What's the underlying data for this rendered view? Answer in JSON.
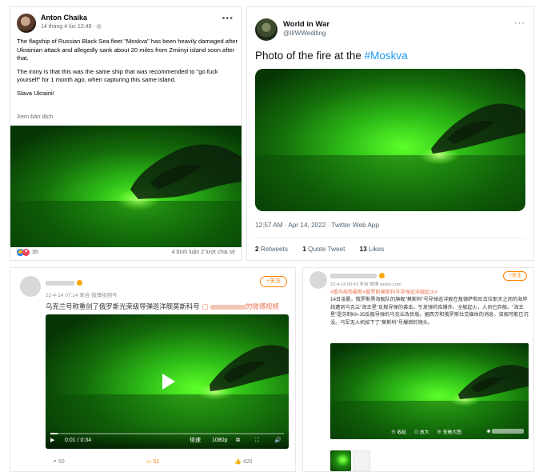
{
  "colors": {
    "facebook_like": "#1877f2",
    "facebook_love": "#f33e58",
    "twitter_link": "#1d9bf0",
    "weibo_accent": "#ff8200",
    "weibo_link": "#eb7350",
    "night_vision_green": "#2fbf18"
  },
  "facebook": {
    "name": "Anton Chaika",
    "time": "14 tháng 4 lúc 12:49 · ◎",
    "paragraphs": [
      "The flagship of Russian Black Sea fleet \"Moskva\" has been heavily damaged after Ukrainian attack and allegedly sank about 20 miles from Zmiinyi island soon after that.",
      "The irony is that this was the same ship that was recommended to \"go fuck yourself\" for 1 month ago, when capturing this same island.",
      "Slava Ukraini!"
    ],
    "translate": "Xem bản dịch",
    "reactions": "35",
    "comments_shares": "4 bình luận  2 lượt chia sẻ",
    "icons": [
      "like-icon",
      "love-icon",
      "more-icon"
    ]
  },
  "twitter": {
    "name": "World in War",
    "handle": "@IIIWWediting",
    "text_prefix": "Photo of the fire at the ",
    "hashtag": "#Moskva",
    "meta": "12:57 AM · Apr 14, 2022 · Twitter Web App",
    "retweets_count": "2",
    "retweets_label": "Retweets",
    "quotes_count": "1",
    "quotes_label": "Quote Tweet",
    "likes_count": "13",
    "likes_label": "Likes"
  },
  "weibo1": {
    "date": "22-4-14 07:14",
    "source": "来自 微博视频号",
    "text": "乌克兰号称重创了俄罗斯光荣级导弹巡洋舰莫斯科号",
    "link": "的微博视频",
    "follow": "+关注",
    "time_display": "0:01 / 0:34",
    "speed": "倍速",
    "quality": "1080p",
    "progress_fraction": 0.03,
    "shares": "50",
    "comments": "51",
    "likes": "420",
    "icons": [
      "play-icon",
      "pip-icon",
      "fullscreen-icon",
      "volume-icon",
      "share-icon",
      "comment-icon",
      "like-icon"
    ]
  },
  "weibo2": {
    "meta": "22-4-14 08:43 来自 微博 weibo.com",
    "follow": "+关注",
    "tags": "#俄乌局势最新#俄罗斯莫斯科号导弹巡洋舰起火#",
    "body": "14日凌晨，俄罗斯黑海舰队的旗舰\"莫斯科\"号导弹巡洋舰在敖德萨和尼古拉耶夫之间的海岸线遭到乌克兰\"海王星\"反舰导弹的袭击，引发弹药库爆炸，全舰起火，人员已弃舰。\"海王星\"是苏制Kh-35反舰导弹的乌克兰改良版。据西方和俄罗斯社交媒体的消息，该舰可能已沉没。乌军无人机拍下了\"莫斯科\"号爆燃的镜头。",
    "btn_collect": "收起",
    "btn_zoom": "查看大图",
    "btn_rotate": "查看大图",
    "btn_labels": [
      "⊖ 收起",
      "⊙ 放大",
      "⊕ 查看大图"
    ]
  }
}
